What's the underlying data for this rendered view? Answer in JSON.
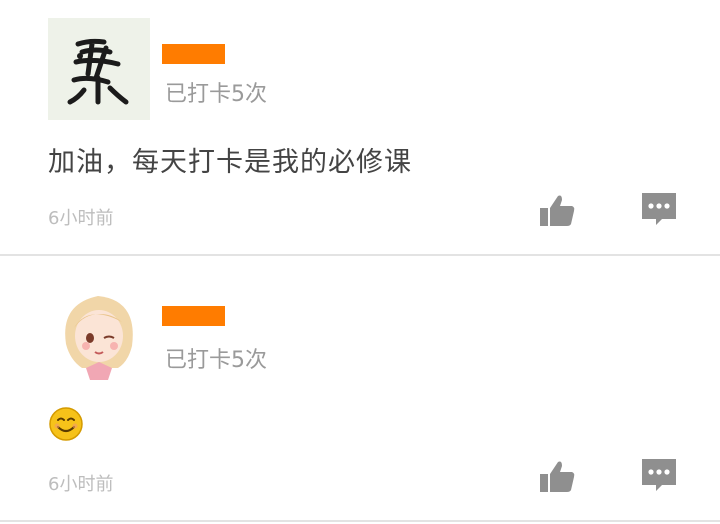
{
  "posts": [
    {
      "checkin_text": "已打卡5次",
      "content_text": "加油，每天打卡是我的必修课",
      "timestamp": "6小时前",
      "avatar_icon": "calligraphy-avatar",
      "username_redacted": true
    },
    {
      "checkin_text": "已打卡5次",
      "emoji_icon": "smiling-emoji",
      "timestamp": "6小时前",
      "avatar_icon": "cartoon-girl-avatar",
      "username_redacted": true
    }
  ],
  "icons": {
    "like": "thumbs-up-icon",
    "comment": "comment-bubble-icon"
  },
  "colors": {
    "redaction": "#ff7c00",
    "icon_gray": "#8f8f8f",
    "emoji_yellow": "#f6c21a"
  }
}
